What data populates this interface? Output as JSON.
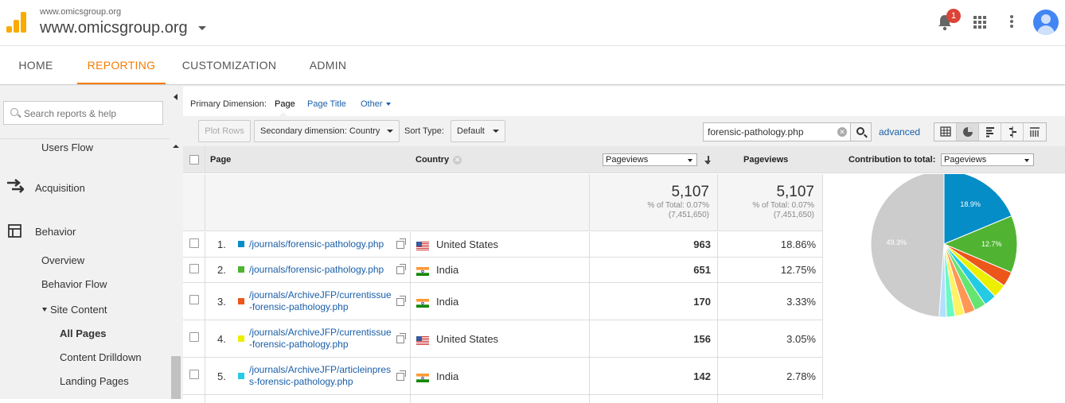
{
  "topbar": {
    "account_small": "www.omicsgroup.org",
    "account_big": "www.omicsgroup.org",
    "notification_count": "1",
    "brand_color": "#f9ab00"
  },
  "nav": {
    "tabs": [
      {
        "label": "HOME"
      },
      {
        "label": "REPORTING"
      },
      {
        "label": "CUSTOMIZATION"
      },
      {
        "label": "ADMIN"
      }
    ],
    "active": "REPORTING",
    "accent_color": "#f57c00"
  },
  "sidebar": {
    "search_placeholder": "Search reports & help",
    "items": [
      {
        "label": "Users Flow"
      },
      {
        "label": "Acquisition"
      },
      {
        "label": "Behavior"
      },
      {
        "label": "Overview"
      },
      {
        "label": "Behavior Flow"
      },
      {
        "label": "Site Content"
      },
      {
        "label": "All Pages"
      },
      {
        "label": "Content Drilldown"
      },
      {
        "label": "Landing Pages"
      }
    ]
  },
  "report": {
    "primary_dimension_label": "Primary Dimension:",
    "dim_page": "Page",
    "dim_page_title": "Page Title",
    "dim_other": "Other",
    "plot_rows": "Plot Rows",
    "secondary_dimension": "Secondary dimension: Country",
    "sort_type_label": "Sort Type:",
    "sort_type_value": "Default",
    "filter_value": "forensic-pathology.php",
    "advanced": "advanced",
    "columns": {
      "page": "Page",
      "country": "Country",
      "metric_select": "Pageviews",
      "pageviews": "Pageviews",
      "contribution_label": "Contribution to total:",
      "contribution_select": "Pageviews"
    },
    "totals": {
      "value": "5,107",
      "pct_of_total": "% of Total: 0.07%",
      "grand_total": "(7,451,650)"
    },
    "rows": [
      {
        "n": "1.",
        "page": "/journals/forensic-pathology.php",
        "country": "United States",
        "flag": "us",
        "pageviews": "963",
        "pct": "18.86%",
        "color": "#058dc7"
      },
      {
        "n": "2.",
        "page": "/journals/forensic-pathology.php",
        "country": "India",
        "flag": "in",
        "pageviews": "651",
        "pct": "12.75%",
        "color": "#50b432"
      },
      {
        "n": "3.",
        "page": "/journals/ArchiveJFP/currentissue-forensic-pathology.php",
        "country": "India",
        "flag": "in",
        "pageviews": "170",
        "pct": "3.33%",
        "color": "#ed561b"
      },
      {
        "n": "4.",
        "page": "/journals/ArchiveJFP/currentissue-forensic-pathology.php",
        "country": "United States",
        "flag": "us",
        "pageviews": "156",
        "pct": "3.05%",
        "color": "#edef00"
      },
      {
        "n": "5.",
        "page": "/journals/ArchiveJFP/articleinpress-forensic-pathology.php",
        "country": "India",
        "flag": "in",
        "pageviews": "142",
        "pct": "2.78%",
        "color": "#24cbe5"
      }
    ]
  },
  "chart_data": {
    "type": "pie",
    "slices": [
      {
        "value": 18.86,
        "color": "#058dc7",
        "label": "18.9%"
      },
      {
        "value": 12.75,
        "color": "#50b432",
        "label": "12.7%"
      },
      {
        "value": 3.33,
        "color": "#ed561b",
        "label": ""
      },
      {
        "value": 3.05,
        "color": "#edef00",
        "label": ""
      },
      {
        "value": 2.78,
        "color": "#24cbe5",
        "label": ""
      },
      {
        "value": 2.6,
        "color": "#64e572",
        "label": ""
      },
      {
        "value": 2.4,
        "color": "#ff9655",
        "label": ""
      },
      {
        "value": 2.2,
        "color": "#fff263",
        "label": ""
      },
      {
        "value": 1.9,
        "color": "#6af9c4",
        "label": ""
      },
      {
        "value": 1.6,
        "color": "#b2deff",
        "label": ""
      },
      {
        "value": 49.3,
        "color": "#cccccc",
        "label": "49.3%"
      }
    ]
  }
}
